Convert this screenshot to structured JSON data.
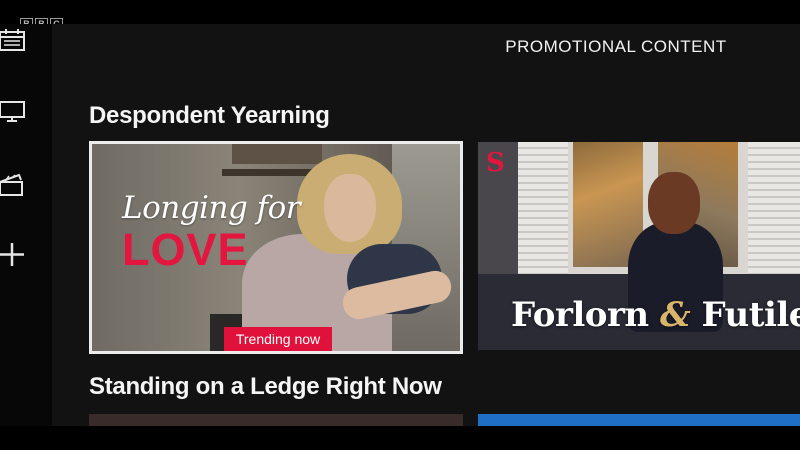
{
  "broadcaster": {
    "logo_letters": [
      "B",
      "B",
      "C"
    ]
  },
  "header": {
    "title": "PROMOTIONAL CONTENT"
  },
  "sidebar": {
    "items": [
      {
        "icon": "calendar-icon"
      },
      {
        "icon": "tv-icon"
      },
      {
        "icon": "clapperboard-icon"
      },
      {
        "icon": "plus-icon"
      }
    ]
  },
  "rows": [
    {
      "title": "Despondent Yearning",
      "cards": [
        {
          "art_line1": "Longing for",
          "art_line2": "LOVE",
          "badge": "Trending now",
          "selected": true
        },
        {
          "art_mark": "S",
          "art_title_a": "Forlorn ",
          "art_title_amp": "&",
          "art_title_b": " Futile"
        }
      ]
    },
    {
      "title": "Standing on a Ledge Right Now"
    }
  ],
  "colors": {
    "accent": "#e3163f",
    "focus_border": "#ececec",
    "background": "#121212"
  }
}
